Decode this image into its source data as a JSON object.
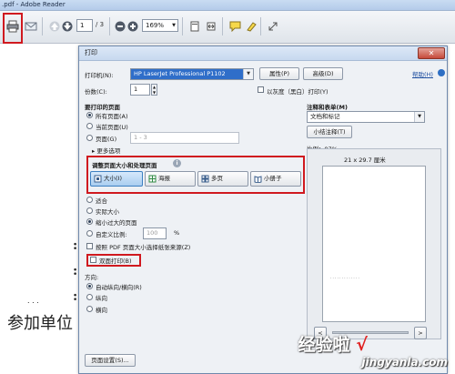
{
  "window": {
    "title": ".pdf - Adobe Reader"
  },
  "toolbar": {
    "page_current": "1",
    "page_total": "/ 3",
    "zoom": "169%"
  },
  "document": {
    "bullet_lines": [
      ":",
      ":",
      ":"
    ],
    "dots": ". . .",
    "visible_text": "参加单位"
  },
  "dialog": {
    "title": "打印",
    "close_glyph": "✕",
    "help_label": "帮助(H)",
    "printer_label": "打印机(N):",
    "printer_value": "HP LaserJet Professional P1102",
    "properties_button": "属性(P)",
    "advanced_button": "高级(D)",
    "copies_label": "份数(C):",
    "copies_value": "1",
    "grayscale_label": "以灰度（黑白）打印(Y)",
    "pages_section_title": "要打印的页面",
    "pages_all": "所有页面(A)",
    "pages_current": "当前页面(U)",
    "pages_range_label": "页面(G)",
    "pages_range_value": "1 - 3",
    "more_options": "▸ 更多选项",
    "sizing_title": "调整页面大小和处理页面",
    "sizing_info_glyph": "i",
    "size_buttons": [
      "大小(I)",
      "海报",
      "多页",
      "小册子"
    ],
    "fit_option": "适合",
    "actual_size": "实际大小",
    "shrink_option": "缩小过大的页面",
    "custom_scale_label": "自定义比例:",
    "custom_scale_value": "100",
    "custom_scale_unit": "%",
    "pdf_paper_source": "按照 PDF 页面大小选择纸张来源(Z)",
    "duplex_label": "双面打印(B)",
    "orientation_title": "方向:",
    "orientation_auto": "自动纵向/横向(R)",
    "orientation_portrait": "纵向",
    "orientation_landscape": "横向",
    "page_setup_button": "页面设置(S)...",
    "comments_title": "注释和表单(M)",
    "comments_value": "文档和标记",
    "summarize_button": "小结注释(T)",
    "scale_label": "比例：97%",
    "paper_size": "21 x 29.7 厘米",
    "preview_lines": "·  · · ·  · ·  · · · · ·  · ·",
    "nav_prev": "<",
    "nav_next": ">"
  },
  "watermark": {
    "main": "经验啦",
    "check": "√",
    "sub": "jingyanla.com"
  },
  "colors": {
    "highlight_red": "#d0191f",
    "printer_select_blue": "#2f6ec9"
  }
}
